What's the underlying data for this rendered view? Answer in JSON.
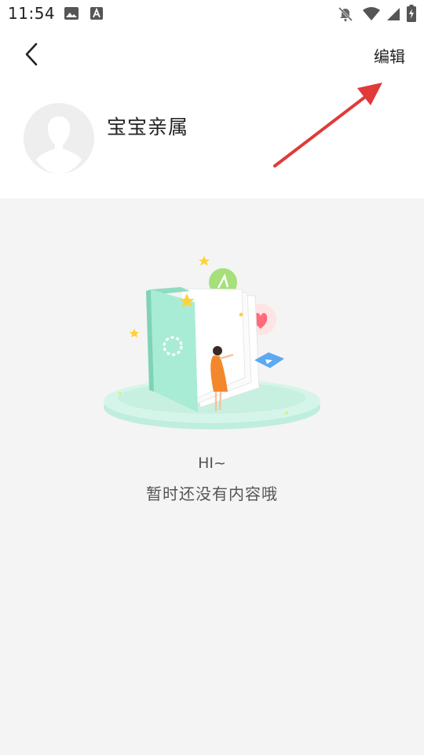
{
  "status_bar": {
    "time": "11:54",
    "icons": [
      "photo-icon",
      "font-icon",
      "bell-off-icon",
      "wifi-icon",
      "signal-icon",
      "battery-charging-icon"
    ]
  },
  "nav": {
    "back_icon": "chevron-left-icon",
    "edit_label": "编辑"
  },
  "profile": {
    "avatar_icon": "person-silhouette-icon",
    "name": "宝宝亲属"
  },
  "empty_state": {
    "title": "HI~",
    "message": "暂时还没有内容哦"
  },
  "colors": {
    "annotation_arrow": "#e03a3a",
    "accent_mint": "#9ee8cc",
    "background": "#f4f4f4"
  }
}
